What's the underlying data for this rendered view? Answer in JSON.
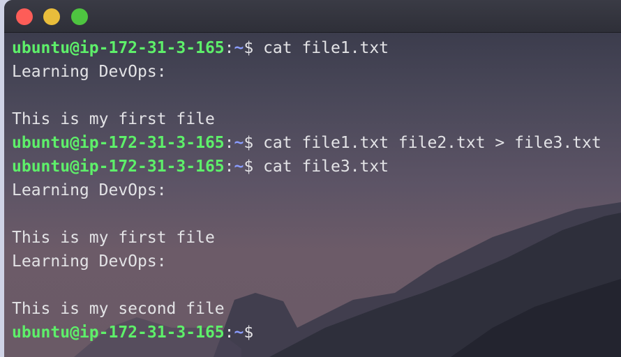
{
  "window": {
    "buttons": [
      "close",
      "minimize",
      "maximize"
    ]
  },
  "terminal": {
    "lines": [
      {
        "type": "prompt",
        "user_host": "ubuntu@ip-172-31-3-165",
        "sep": ":",
        "path": "~",
        "sym": "$",
        "cmd": " cat file1.txt"
      },
      {
        "type": "output",
        "text": "Learning DevOps:"
      },
      {
        "type": "output",
        "text": ""
      },
      {
        "type": "output",
        "text": "This is my first file"
      },
      {
        "type": "prompt",
        "user_host": "ubuntu@ip-172-31-3-165",
        "sep": ":",
        "path": "~",
        "sym": "$",
        "cmd": " cat file1.txt file2.txt > file3.txt"
      },
      {
        "type": "prompt",
        "user_host": "ubuntu@ip-172-31-3-165",
        "sep": ":",
        "path": "~",
        "sym": "$",
        "cmd": " cat file3.txt"
      },
      {
        "type": "output",
        "text": "Learning DevOps:"
      },
      {
        "type": "output",
        "text": ""
      },
      {
        "type": "output",
        "text": "This is my first file"
      },
      {
        "type": "output",
        "text": "Learning DevOps:"
      },
      {
        "type": "output",
        "text": ""
      },
      {
        "type": "output",
        "text": "This is my second file"
      },
      {
        "type": "prompt",
        "user_host": "ubuntu@ip-172-31-3-165",
        "sep": ":",
        "path": "~",
        "sym": "$",
        "cmd": ""
      }
    ]
  },
  "colors": {
    "prompt_user": "#5ef06a",
    "prompt_path": "#8a9cff",
    "text": "#e3e3e6"
  }
}
